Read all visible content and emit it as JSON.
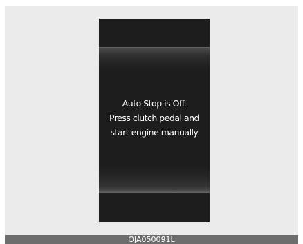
{
  "display": {
    "message_lines": [
      "Auto Stop is Off.",
      "Press clutch pedal and",
      "start engine manually"
    ]
  },
  "caption": {
    "code": "OJA050091L"
  }
}
